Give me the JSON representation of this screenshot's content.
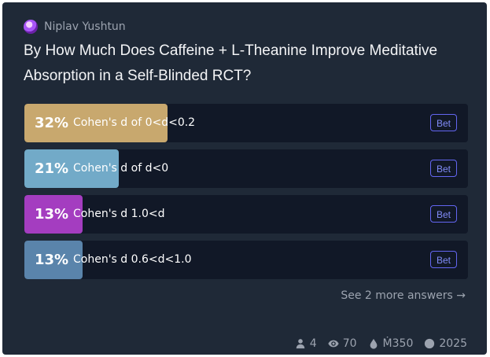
{
  "author": {
    "name": "Niplav Yushtun"
  },
  "question": {
    "title": "By How Much Does Caffeine + L-Theanine Improve Meditative Absorption in a Self-Blinded RCT?"
  },
  "answers": [
    {
      "percent": 32,
      "percent_label": "32%",
      "label": "Cohen's d of 0<d<0.2",
      "bet_label": "Bet",
      "color": "#c8a86e"
    },
    {
      "percent": 21,
      "percent_label": "21%",
      "label": "Cohen's d of d<0",
      "bet_label": "Bet",
      "color": "#72aac8"
    },
    {
      "percent": 13,
      "percent_label": "13%",
      "label": "Cohen's d 1.0<d",
      "bet_label": "Bet",
      "color": "#a43dc0"
    },
    {
      "percent": 13,
      "percent_label": "13%",
      "label": "Cohen's d 0.6<d<1.0",
      "bet_label": "Bet",
      "color": "#5a84ab"
    }
  ],
  "see_more": "See 2 more answers →",
  "stats": {
    "traders": "4",
    "views": "70",
    "volume": "Ṁ350",
    "closes": "2025"
  },
  "icons": {
    "traders": "person-icon",
    "views": "eye-icon",
    "volume": "droplet-icon",
    "closes": "clock-icon"
  }
}
